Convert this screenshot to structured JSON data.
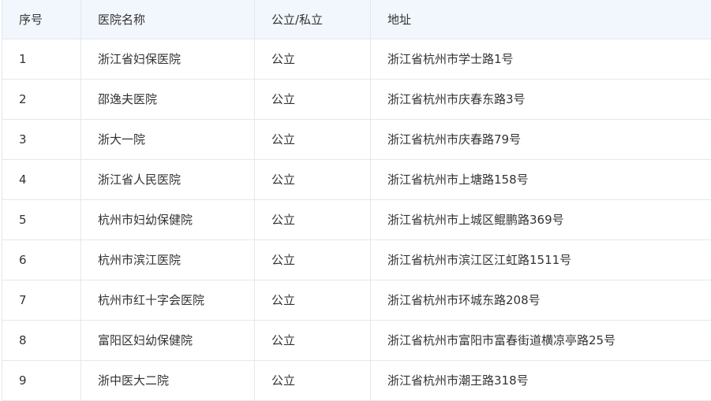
{
  "table": {
    "headers": [
      "序号",
      "医院名称",
      "公立/私立",
      "地址"
    ],
    "rows": [
      [
        "1",
        "浙江省妇保医院",
        "公立",
        "浙江省杭州市学士路1号"
      ],
      [
        "2",
        "邵逸夫医院",
        "公立",
        "浙江省杭州市庆春东路3号"
      ],
      [
        "3",
        "浙大一院",
        "公立",
        "浙江省杭州市庆春路79号"
      ],
      [
        "4",
        "浙江省人民医院",
        "公立",
        "浙江省杭州市上塘路158号"
      ],
      [
        "5",
        "杭州市妇幼保健院",
        "公立",
        "浙江省杭州市上城区鲲鹏路369号"
      ],
      [
        "6",
        "杭州市滨江医院",
        "公立",
        "浙江省杭州市滨江区江虹路1511号"
      ],
      [
        "7",
        "杭州市红十字会医院",
        "公立",
        "浙江省杭州市环城东路208号"
      ],
      [
        "8",
        "富阳区妇幼保健院",
        "公立",
        "浙江省杭州市富阳市富春街道横凉亭路25号"
      ],
      [
        "9",
        "浙中医大二院",
        "公立",
        "浙江省杭州市潮王路318号"
      ]
    ]
  }
}
